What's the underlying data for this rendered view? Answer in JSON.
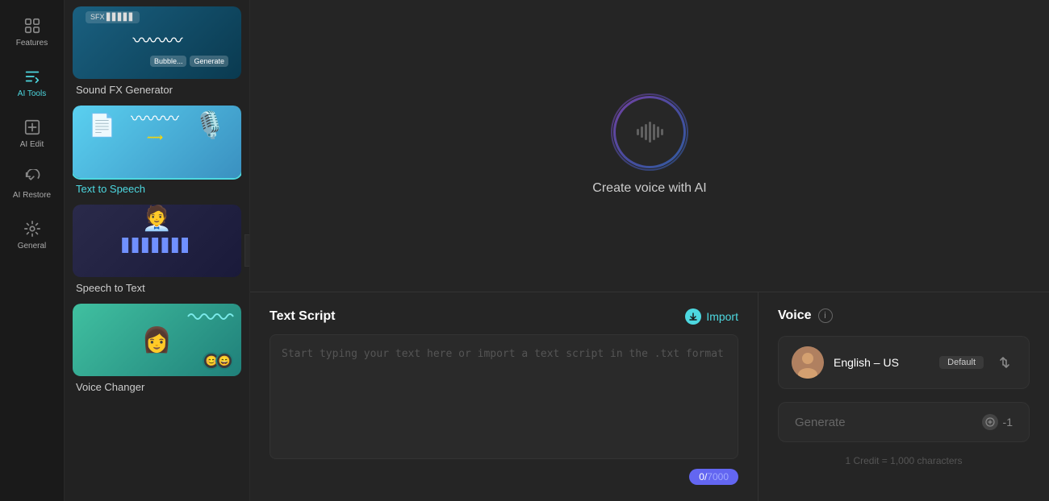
{
  "sidebar": {
    "items": [
      {
        "id": "features",
        "label": "Features",
        "icon": "⊞"
      },
      {
        "id": "ai-tools",
        "label": "AI Tools",
        "icon": "🔧",
        "active": true
      },
      {
        "id": "ai-edit",
        "label": "AI Edit",
        "icon": "✏️"
      },
      {
        "id": "ai-restore",
        "label": "AI Restore",
        "icon": "♪"
      },
      {
        "id": "general",
        "label": "General",
        "icon": "⊡"
      }
    ]
  },
  "tools": [
    {
      "id": "sfx",
      "name": "Sound FX Generator",
      "active": false
    },
    {
      "id": "tts",
      "name": "Text to Speech",
      "active": true
    },
    {
      "id": "stt",
      "name": "Speech to Text",
      "active": false
    },
    {
      "id": "vc",
      "name": "Voice Changer",
      "active": false
    }
  ],
  "preview": {
    "create_label": "Create voice with AI"
  },
  "script_section": {
    "title": "Text Script",
    "import_label": "Import",
    "placeholder": "Start typing your text here or import a text script in the .txt format",
    "current_chars": "0",
    "max_chars": "7000"
  },
  "voice_section": {
    "title": "Voice",
    "voice_name": "English – US",
    "default_badge": "Default",
    "generate_label": "Generate",
    "credit_cost": "-1",
    "credit_info": "1 Credit = 1,000 characters"
  }
}
